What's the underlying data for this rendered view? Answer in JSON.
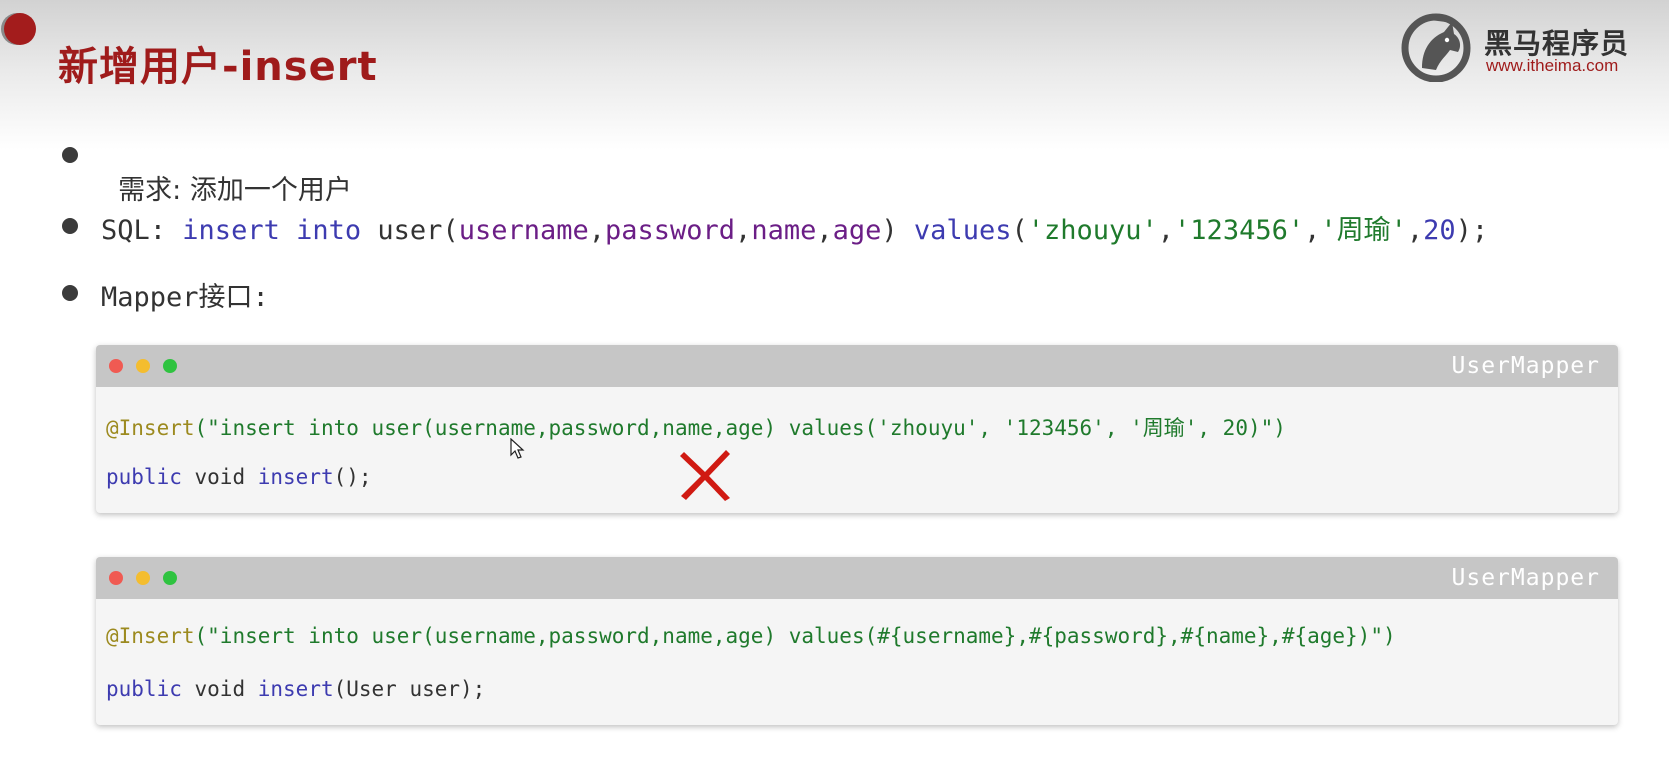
{
  "slide": {
    "title": "新增用户-insert"
  },
  "logo": {
    "name_cn": "黑马程序员",
    "url": "www.itheima.com"
  },
  "bullets": {
    "req_label": "需求:",
    "req_text": "添加一个用户",
    "sql_label": "SQL:",
    "sql": {
      "kw_insert": "insert",
      "kw_into": "into",
      "table": "user(",
      "c1": "username",
      "c2": "password",
      "c3": "name",
      "c4": "age",
      "close": ")",
      "kw_values": "values",
      "open": "(",
      "v1": "'zhouyu'",
      "v2": "'123456'",
      "v3": "'周瑜'",
      "v4": "20",
      "end": ");"
    },
    "mapper_label": "Mapper接口:"
  },
  "code_blocks": [
    {
      "filename": "UserMapper",
      "annotation": "@Insert",
      "annotation_string": "(\"insert into user(username,password,name,age) values('zhouyu', '123456', '周瑜', 20)\")",
      "modifier": "public",
      "type": "void",
      "method": "insert",
      "params": "();"
    },
    {
      "filename": "UserMapper",
      "annotation": "@Insert",
      "annotation_string": "(\"insert into user(username,password,name,age) values(#{username},#{password},#{name},#{age})\")",
      "modifier": "public",
      "type": "void",
      "method": "insert",
      "params": "(User user);"
    }
  ],
  "icons": {
    "wrong_mark": "red-x-icon",
    "cursor": "mouse-cursor-icon",
    "logo": "horse-logo-icon"
  },
  "colors": {
    "title_red": "#9f1b1b",
    "keyword": "#3d3bb0",
    "string": "#1f7a2c",
    "column": "#6b1e86",
    "annotation": "#9c8a1f",
    "x_mark": "#d01a12"
  }
}
